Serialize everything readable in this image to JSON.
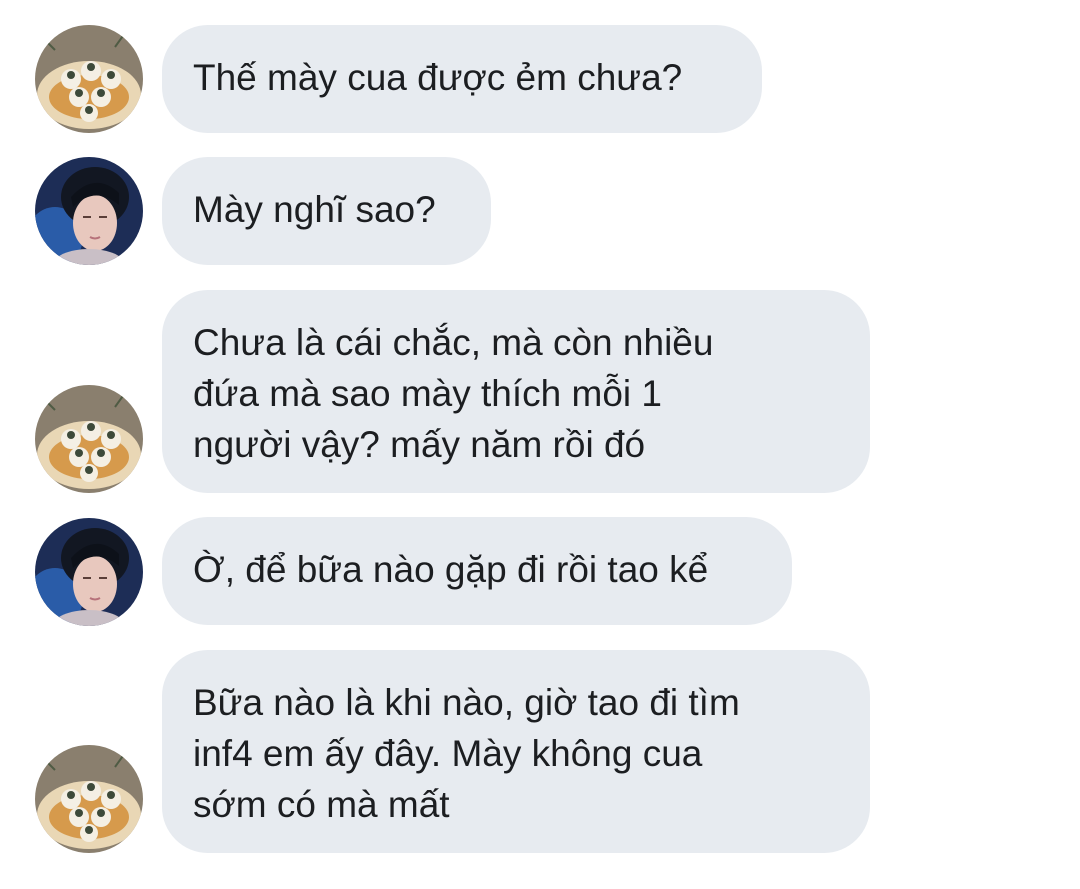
{
  "conversation": {
    "messages": [
      {
        "sender": "friend",
        "avatar": "dessert-avatar",
        "text": "Thế mày cua được ẻm chưa?"
      },
      {
        "sender": "me",
        "avatar": "boy-portrait-avatar",
        "text": "Mày nghĩ sao?"
      },
      {
        "sender": "friend",
        "avatar": "dessert-avatar",
        "text": "Chưa là cái chắc, mà còn nhiều\nđứa mà sao mày thích mỗi 1\nngười vậy? mấy năm rồi đó"
      },
      {
        "sender": "me",
        "avatar": "boy-portrait-avatar",
        "text": "Ờ, để bữa nào gặp đi rồi tao kể"
      },
      {
        "sender": "friend",
        "avatar": "dessert-avatar",
        "text": "Bữa nào là khi nào, giờ tao đi tìm\ninf4 em ấy đây. Mày không cua\nsớm có mà mất"
      }
    ]
  },
  "colors": {
    "bubble_background": "#e7ebf0",
    "text": "#1c1e21",
    "page_background": "#ffffff"
  }
}
